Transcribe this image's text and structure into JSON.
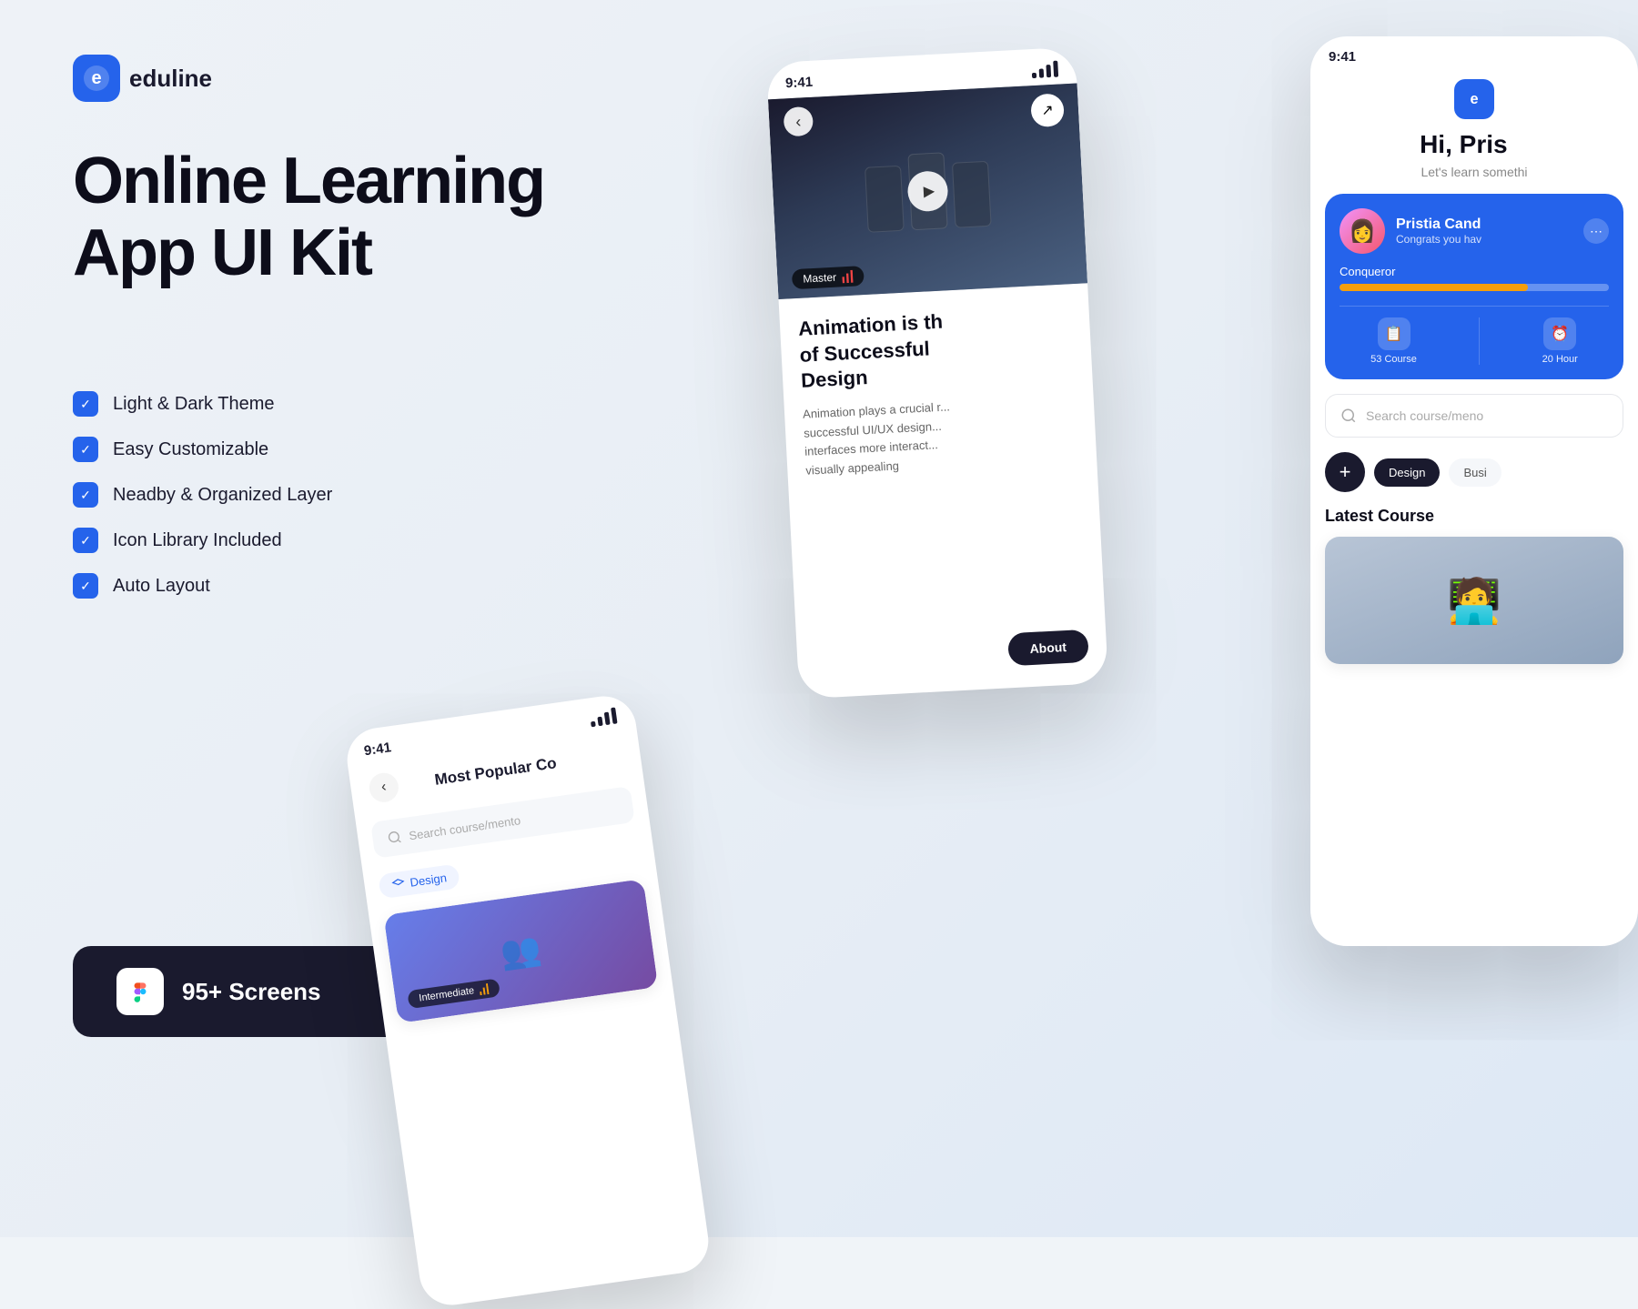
{
  "brand": {
    "logo_letter": "e",
    "name": "eduline"
  },
  "hero": {
    "title_line1": "Online Learning",
    "title_line2": "App UI Kit"
  },
  "features": [
    {
      "id": 1,
      "label": "Light & Dark Theme"
    },
    {
      "id": 2,
      "label": "Easy Customizable"
    },
    {
      "id": 3,
      "label": "Neadby & Organized Layer"
    },
    {
      "id": 4,
      "label": "Icon Library Included"
    },
    {
      "id": 5,
      "label": "Auto Layout"
    }
  ],
  "cta": {
    "screens_count": "95+ Screens",
    "figma_icon": "❋"
  },
  "phone_middle": {
    "status_time": "9:41",
    "section_title": "Most Popular Co",
    "search_placeholder": "Search course/mento",
    "category": "Design",
    "badge": "Intermediate"
  },
  "phone_right": {
    "status_time": "9:41",
    "back": "‹",
    "share": "↗",
    "hero_title": "Animation is th of Successful Design",
    "description": "Animation plays a crucial r... successful UI/UX design... interfaces more interact... visually appealing",
    "master_badge": "Master",
    "about_btn": "About",
    "play_icon": "▶"
  },
  "phone_far_right": {
    "status_time": "9:41",
    "greeting": "Hi, Pris",
    "greeting_subtitle": "Let's learn somethi",
    "profile_name": "Pristia Cand",
    "profile_subtitle": "Congrats you hav",
    "profile_level": "Conqueror",
    "progress_percent": 70,
    "stats": [
      {
        "icon": "📋",
        "label": "53 Course"
      },
      {
        "icon": "⏰",
        "label": "20 Hour"
      }
    ],
    "search_placeholder": "Search course/meno",
    "categories": [
      "Design",
      "Busi"
    ],
    "latest_title": "Latest Course",
    "add_icon": "+"
  },
  "colors": {
    "primary": "#2563eb",
    "dark": "#1a1a2e",
    "accent": "#f59e0b",
    "bg": "#eef2f7"
  }
}
